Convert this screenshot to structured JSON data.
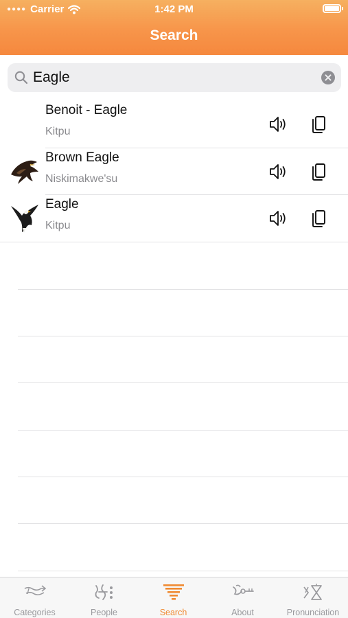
{
  "status_bar": {
    "carrier": "Carrier",
    "time": "1:42 PM"
  },
  "header": {
    "title": "Search"
  },
  "search": {
    "value": "Eagle",
    "placeholder": ""
  },
  "results": [
    {
      "name": "Benoit - Eagle",
      "translation": "Kitpu",
      "thumbnail": "none"
    },
    {
      "name": "Brown Eagle",
      "translation": "Niskimakwe'su",
      "thumbnail": "brown-eagle-photo"
    },
    {
      "name": "Eagle",
      "translation": "Kitpu",
      "thumbnail": "bald-eagle-photo"
    }
  ],
  "tabs": [
    {
      "label": "Categories",
      "icon": "categories-glyph-icon",
      "active": false
    },
    {
      "label": "People",
      "icon": "people-glyph-icon",
      "active": false
    },
    {
      "label": "Search",
      "icon": "search-glyph-icon",
      "active": true
    },
    {
      "label": "About",
      "icon": "about-glyph-icon",
      "active": false
    },
    {
      "label": "Pronunciation",
      "icon": "pronunciation-glyph-icon",
      "active": false
    }
  ],
  "colors": {
    "header": "#f7954a",
    "active_tab": "#f08a32",
    "inactive_tab": "#9a9a9e"
  }
}
